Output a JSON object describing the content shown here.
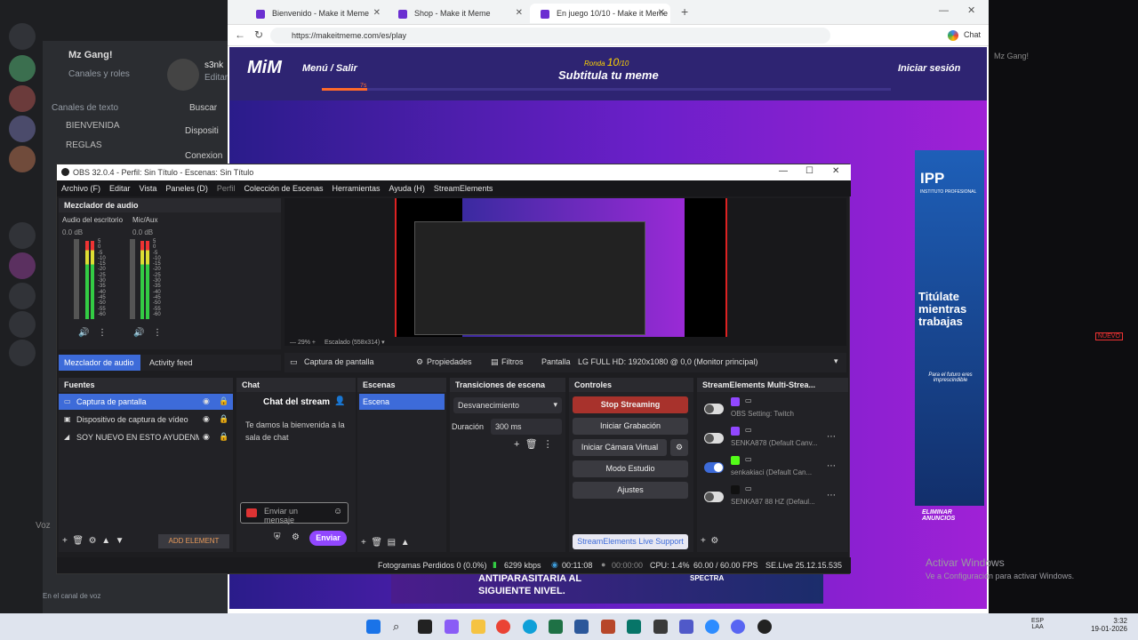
{
  "discord": {
    "server_name": "Mz Gang!",
    "subtitle": "Canales y roles",
    "username": "s3nk",
    "user_status": "Editar",
    "section": "Canales de texto",
    "channels": [
      "BIENVENIDA",
      "REGLAS"
    ],
    "search": "Buscar",
    "menu_items": [
      "Dispositi",
      "Conexion"
    ],
    "voice": "Voz",
    "voice_sub": "En el canal de voz",
    "mention": "Mz Gang!",
    "badge": "NUEVO"
  },
  "browser": {
    "tabs": [
      "Bienvenido - Make it Meme",
      "Shop - Make it Meme",
      "En juego 10/10 - Make it Meme"
    ],
    "url": "https://makeitmeme.com/es/play",
    "chat_label": "Chat"
  },
  "site": {
    "logo": "MiM",
    "menu": "Menú / Salir",
    "round_label": "Ronda",
    "round": "10",
    "round_total": "/10",
    "title": "Subtitula tu meme",
    "login": "Iniciar sesión",
    "timer": "7s",
    "ad_right": {
      "brand": "IPP",
      "brand_sub": "INSTITUTO PROFESIONAL",
      "headline": "Titúlate mientras trabajas",
      "sub": "Para el futuro eres imprescindible",
      "remove": "ELIMINAR ANUNCIOS"
    },
    "ad_bottom": {
      "text1": "ANTIPARASITARIA AL",
      "text2": "SIGUIENTE NIVEL.",
      "brand": "SPECTRA"
    }
  },
  "obs": {
    "title": "OBS 32.0.4 - Perfil: Sin Título - Escenas: Sin Título",
    "menu": [
      "Archivo (F)",
      "Editar",
      "Vista",
      "Paneles (D)",
      "Perfil",
      "Colección de Escenas",
      "Herramientas",
      "Ayuda (H)",
      "StreamElements"
    ],
    "mixer": {
      "title": "Mezclador de audio",
      "ch1": "Audio del escritorio",
      "ch2": "Mic/Aux",
      "db1": "0.0 dB",
      "db2": "0.0 dB",
      "scale": [
        "5",
        "0",
        "-5",
        "-10",
        "-15",
        "-20",
        "-25",
        "-30",
        "-35",
        "-40",
        "-45",
        "-50",
        "-55",
        "-60"
      ]
    },
    "preview": {
      "zoom": "29%",
      "scale": "Escalado (558x314)"
    },
    "tabs": [
      "Mezclador de audio",
      "Activity feed"
    ],
    "source_bar": {
      "source": "Captura de pantalla",
      "props": "Propiedades",
      "filters": "Filtros",
      "screen_label": "Pantalla",
      "screen_value": "LG FULL HD: 1920x1080 @ 0,0 (Monitor principal)"
    },
    "sources": {
      "title": "Fuentes",
      "items": [
        "Captura de pantalla",
        "Dispositivo de captura de vídeo",
        "SOY NUEVO EN ESTO AYUDENME A"
      ],
      "add": "ADD ELEMENT"
    },
    "chat": {
      "title": "Chat",
      "header": "Chat del stream",
      "welcome": "Te damos la bienvenida a la sala de chat",
      "placeholder": "Enviar un mensaje",
      "send": "Enviar"
    },
    "scenes": {
      "title": "Escenas",
      "items": [
        "Escena"
      ]
    },
    "transitions": {
      "title": "Transiciones de escena",
      "value": "Desvanecimiento",
      "duration_label": "Duración",
      "duration": "300 ms"
    },
    "controls": {
      "title": "Controles",
      "stop": "Stop Streaming",
      "record": "Iniciar Grabación",
      "vcam": "Iniciar Cámara Virtual",
      "studio": "Modo Estudio",
      "settings": "Ajustes",
      "support": "StreamElements Live Support"
    },
    "multistream": {
      "title": "StreamElements Multi-Strea...",
      "items": [
        {
          "label": "OBS Setting: Twitch",
          "platform": "twitch",
          "on": false
        },
        {
          "label": "SENKA878 (Default Canv...",
          "platform": "twitch",
          "on": false
        },
        {
          "label": "senkakiaci (Default Can...",
          "platform": "kick",
          "on": true
        },
        {
          "label": "SENKA87 88 HZ (Defaul...",
          "platform": "tiktok",
          "on": false
        }
      ]
    },
    "status": {
      "dropped": "Fotogramas Perdidos 0 (0.0%)",
      "kbps": "6299 kbps",
      "stream_time": "00:11:08",
      "rec_time": "00:00:00",
      "cpu": "CPU: 1.4%",
      "fps": "60.00 / 60.00 FPS",
      "version": "SE.Live 25.12.15.535"
    }
  },
  "windows": {
    "activate": "Activar Windows",
    "activate_sub": "Ve a Configuración para activar Windows.",
    "lang": "ESP",
    "lang_sub": "LAA",
    "time": "3:32",
    "date": "19-01-2026"
  },
  "colors": {
    "obs_bg": "#1d1d20",
    "accent_blue": "#3d6bd9",
    "stop_red": "#a8322c",
    "site_purple": "#6b1fc9",
    "chat_purple": "#9147ff"
  }
}
